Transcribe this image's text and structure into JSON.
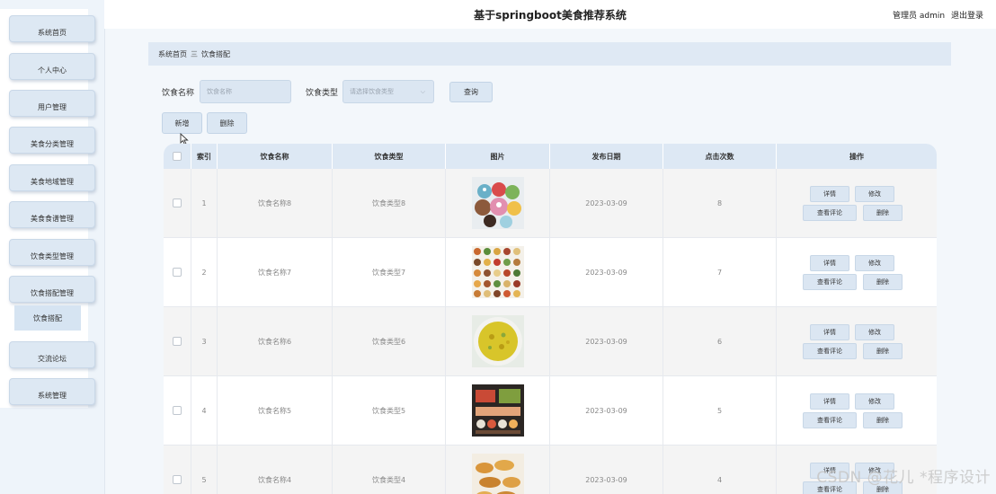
{
  "app": {
    "title": "基于springboot美食推荐系统",
    "user_label": "管理员 admin",
    "logout_label": "退出登录"
  },
  "sidebar": {
    "items": [
      {
        "label": "系统首页"
      },
      {
        "label": "个人中心"
      },
      {
        "label": "用户管理"
      },
      {
        "label": "美食分类管理"
      },
      {
        "label": "美食地域管理"
      },
      {
        "label": "美食食谱管理"
      },
      {
        "label": "饮食类型管理"
      },
      {
        "label": "饮食搭配管理"
      },
      {
        "label": "交流论坛"
      },
      {
        "label": "系统管理"
      }
    ],
    "active_sub": "饮食搭配"
  },
  "breadcrumb": {
    "home": "系统首页",
    "separator": "三",
    "current": "饮食搭配"
  },
  "search": {
    "name_label": "饮食名称",
    "name_placeholder": "饮食名称",
    "type_label": "饮食类型",
    "type_placeholder": "请选择饮食类型",
    "query_button": "查询"
  },
  "toolbar": {
    "add_label": "新增",
    "delete_label": "删除"
  },
  "table": {
    "columns": [
      "索引",
      "饮食名称",
      "饮食类型",
      "图片",
      "发布日期",
      "点击次数",
      "操作"
    ],
    "actions": {
      "detail": "详情",
      "edit": "修改",
      "comments": "查看评论",
      "delete": "删除"
    },
    "rows": [
      {
        "index": "1",
        "name": "饮食名称8",
        "type": "饮食类型8",
        "date": "2023-03-09",
        "clicks": "8",
        "image": "cupcakes-image"
      },
      {
        "index": "2",
        "name": "饮食名称7",
        "type": "饮食类型7",
        "date": "2023-03-09",
        "clicks": "7",
        "image": "food-collage-image"
      },
      {
        "index": "3",
        "name": "饮食名称6",
        "type": "饮食类型6",
        "date": "2023-03-09",
        "clicks": "6",
        "image": "curry-plate-image"
      },
      {
        "index": "4",
        "name": "饮食名称5",
        "type": "饮食类型5",
        "date": "2023-03-09",
        "clicks": "5",
        "image": "sushi-spread-image"
      },
      {
        "index": "5",
        "name": "饮食名称4",
        "type": "饮食类型4",
        "date": "2023-03-09",
        "clicks": "4",
        "image": "pastries-image"
      }
    ]
  },
  "watermark": "CSDN @花儿 *程序设计",
  "colors": {
    "accent": "#dbe6f2",
    "page_bg": "#f3f7fb",
    "header_bg": "#dde8f4"
  }
}
